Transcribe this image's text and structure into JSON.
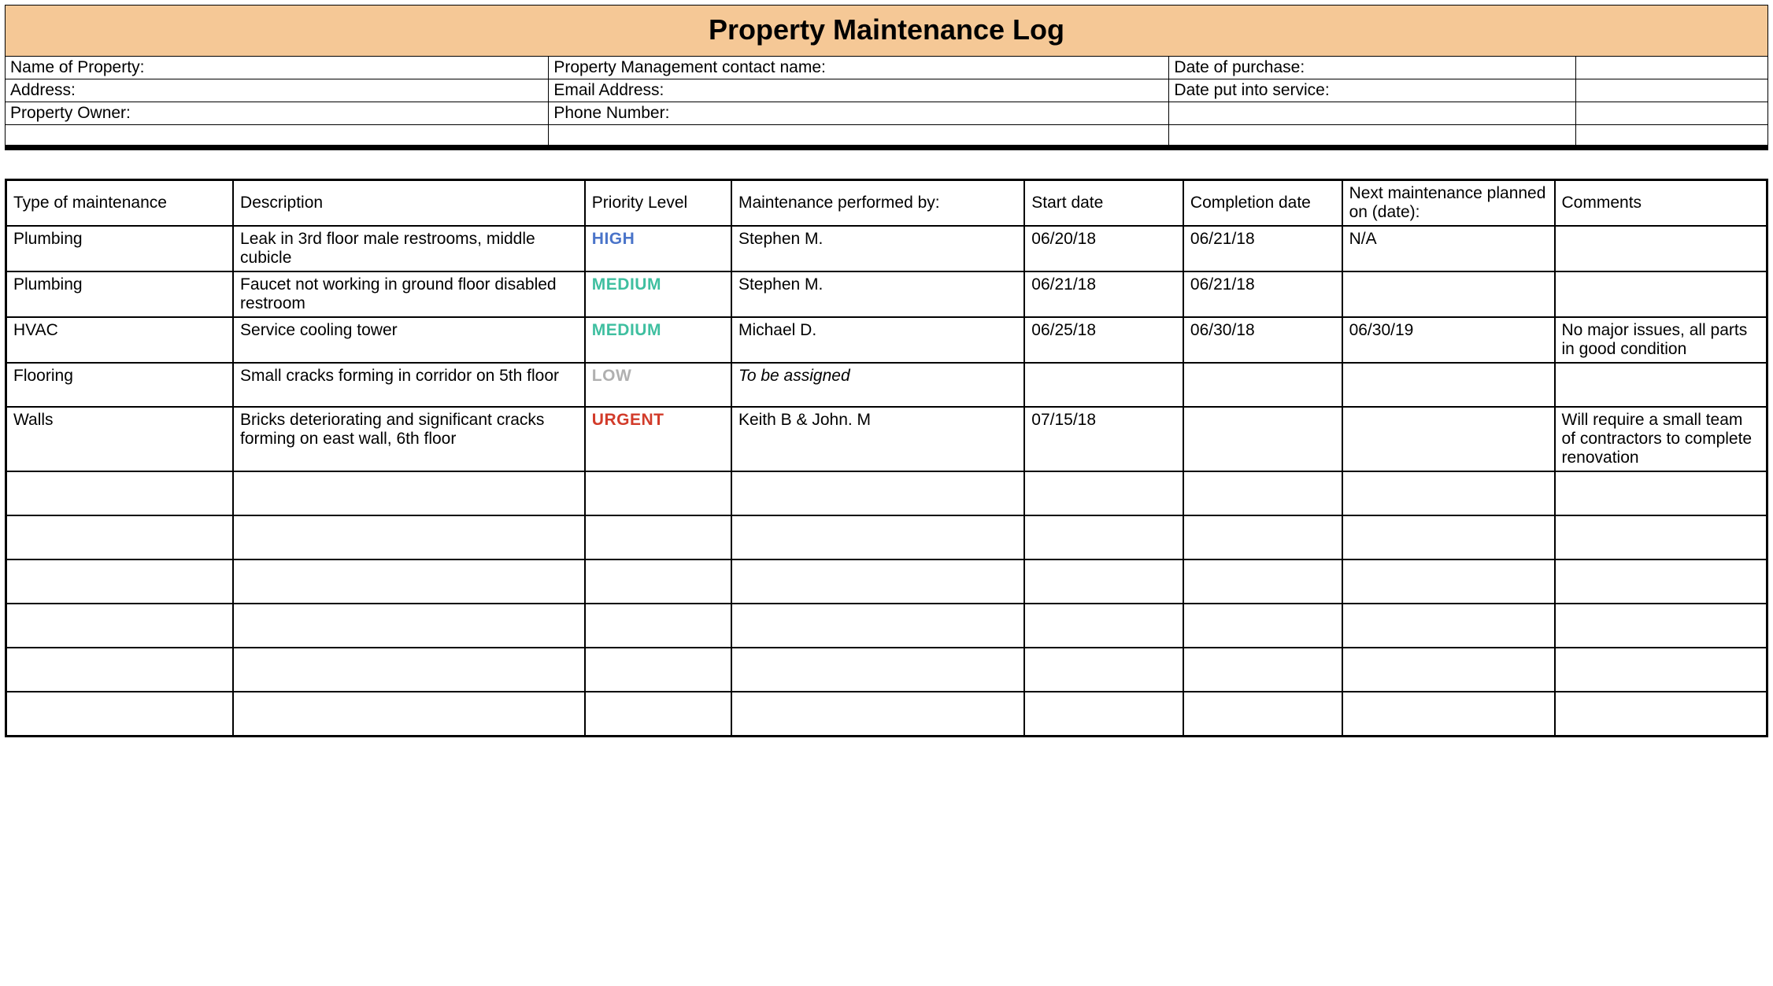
{
  "title": "Property Maintenance Log",
  "info": {
    "rows": [
      [
        {
          "label": "Name of Property:",
          "value": ""
        },
        {
          "label": "Property Management contact name:",
          "value": ""
        },
        {
          "label": "Date of purchase:",
          "value": ""
        },
        {
          "label": "",
          "value": ""
        }
      ],
      [
        {
          "label": "Address:",
          "value": ""
        },
        {
          "label": "Email Address:",
          "value": ""
        },
        {
          "label": "Date put into service:",
          "value": ""
        },
        {
          "label": "",
          "value": ""
        }
      ],
      [
        {
          "label": "Property Owner:",
          "value": ""
        },
        {
          "label": "Phone Number:",
          "value": ""
        },
        {
          "label": "",
          "value": ""
        },
        {
          "label": "",
          "value": ""
        }
      ],
      [
        {
          "label": "",
          "value": ""
        },
        {
          "label": "",
          "value": ""
        },
        {
          "label": "",
          "value": ""
        },
        {
          "label": "",
          "value": ""
        }
      ]
    ]
  },
  "log": {
    "headers": [
      "Type of maintenance",
      "Description",
      "Priority Level",
      "Maintenance performed by:",
      "Start date",
      "Completion date",
      "Next maintenance planned on (date):",
      "Comments"
    ],
    "rows": [
      {
        "type": "Plumbing",
        "description": "Leak in 3rd floor male restrooms, middle cubicle",
        "priority": "HIGH",
        "performed_by": "Stephen M.",
        "performed_by_italic": false,
        "start_date": "06/20/18",
        "completion_date": "06/21/18",
        "next_date": "N/A",
        "comments": ""
      },
      {
        "type": "Plumbing",
        "description": "Faucet not working in ground floor disabled restroom",
        "priority": "MEDIUM",
        "performed_by": "Stephen M.",
        "performed_by_italic": false,
        "start_date": "06/21/18",
        "completion_date": "06/21/18",
        "next_date": "",
        "comments": ""
      },
      {
        "type": "HVAC",
        "description": "Service cooling tower",
        "priority": "MEDIUM",
        "performed_by": "Michael D.",
        "performed_by_italic": false,
        "start_date": "06/25/18",
        "completion_date": "06/30/18",
        "next_date": "06/30/19",
        "comments": "No major issues, all parts in good condition"
      },
      {
        "type": "Flooring",
        "description": "Small cracks forming in corridor on 5th floor",
        "priority": "LOW",
        "performed_by": "To be assigned",
        "performed_by_italic": true,
        "start_date": "",
        "completion_date": "",
        "next_date": "",
        "comments": ""
      },
      {
        "type": "Walls",
        "description": "Bricks deteriorating and significant cracks forming on east wall, 6th floor",
        "priority": "URGENT",
        "performed_by": "Keith B & John. M",
        "performed_by_italic": false,
        "start_date": "07/15/18",
        "completion_date": "",
        "next_date": "",
        "comments": "Will require a small team of contractors to complete renovation"
      },
      {
        "type": "",
        "description": "",
        "priority": "",
        "performed_by": "",
        "performed_by_italic": false,
        "start_date": "",
        "completion_date": "",
        "next_date": "",
        "comments": ""
      },
      {
        "type": "",
        "description": "",
        "priority": "",
        "performed_by": "",
        "performed_by_italic": false,
        "start_date": "",
        "completion_date": "",
        "next_date": "",
        "comments": ""
      },
      {
        "type": "",
        "description": "",
        "priority": "",
        "performed_by": "",
        "performed_by_italic": false,
        "start_date": "",
        "completion_date": "",
        "next_date": "",
        "comments": ""
      },
      {
        "type": "",
        "description": "",
        "priority": "",
        "performed_by": "",
        "performed_by_italic": false,
        "start_date": "",
        "completion_date": "",
        "next_date": "",
        "comments": ""
      },
      {
        "type": "",
        "description": "",
        "priority": "",
        "performed_by": "",
        "performed_by_italic": false,
        "start_date": "",
        "completion_date": "",
        "next_date": "",
        "comments": ""
      },
      {
        "type": "",
        "description": "",
        "priority": "",
        "performed_by": "",
        "performed_by_italic": false,
        "start_date": "",
        "completion_date": "",
        "next_date": "",
        "comments": ""
      }
    ]
  }
}
